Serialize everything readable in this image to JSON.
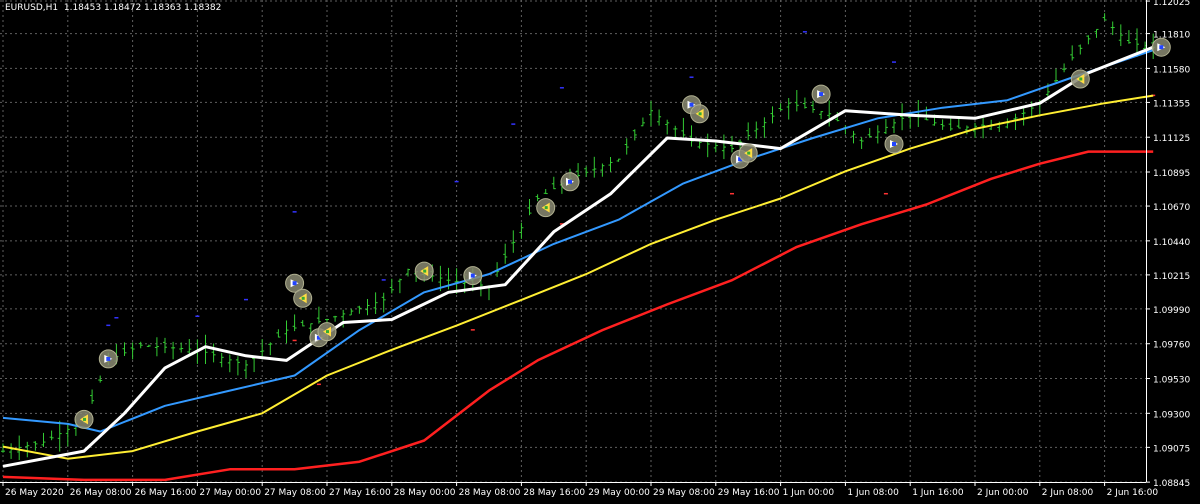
{
  "header": {
    "symbol_tf": "EURUSD,H1",
    "open": "1.18453",
    "high": "1.18472",
    "low": "1.18363",
    "close": "1.18382"
  },
  "colors": {
    "background": "#000000",
    "grid": "#606060",
    "candle": "#33cc33",
    "ma_fast": "#ffffff",
    "ma_mid": "#3399ff",
    "ma_slow": "#ffee33",
    "ma_slowest": "#ff2020",
    "axis_text": "#ffffff",
    "dots_up": "#3333ff",
    "dots_down": "#ff3333"
  },
  "chart_data": {
    "type": "line",
    "symbol": "EURUSD",
    "timeframe": "H1",
    "ylim": [
      1.08846,
      1.12032
    ],
    "y_ticks": [
      "1.12025",
      "1.11810",
      "1.11580",
      "1.11355",
      "1.11125",
      "1.10895",
      "1.10670",
      "1.10440",
      "1.10215",
      "1.09990",
      "1.09760",
      "1.09530",
      "1.09300",
      "1.09075",
      "1.08845"
    ],
    "y_tick_values": [
      1.12025,
      1.1181,
      1.1158,
      1.11355,
      1.11125,
      1.10895,
      1.1067,
      1.1044,
      1.10215,
      1.0999,
      1.0976,
      1.0953,
      1.093,
      1.09075,
      1.08845
    ],
    "x_ticks": [
      "26 May 2020",
      "26 May 08:00",
      "26 May 16:00",
      "27 May 00:00",
      "27 May 08:00",
      "27 May 16:00",
      "28 May 00:00",
      "28 May 08:00",
      "28 May 16:00",
      "29 May 00:00",
      "29 May 08:00",
      "29 May 16:00",
      "1 Jun 00:00",
      "1 Jun 08:00",
      "1 Jun 16:00",
      "2 Jun 00:00",
      "2 Jun 08:00",
      "2 Jun 16:00"
    ],
    "x_tick_index": [
      0,
      8,
      16,
      24,
      32,
      40,
      48,
      56,
      64,
      72,
      80,
      88,
      96,
      104,
      112,
      120,
      128,
      136
    ],
    "bar_count": 143,
    "price_anchors": [
      [
        0,
        1.0905
      ],
      [
        5,
        1.0911
      ],
      [
        10,
        1.0925
      ],
      [
        13,
        1.0965
      ],
      [
        17,
        1.0975
      ],
      [
        24,
        1.0972
      ],
      [
        30,
        1.0962
      ],
      [
        35,
        1.0985
      ],
      [
        40,
        1.0992
      ],
      [
        47,
        1.1005
      ],
      [
        50,
        1.1025
      ],
      [
        55,
        1.1018
      ],
      [
        60,
        1.1014
      ],
      [
        66,
        1.1072
      ],
      [
        70,
        1.1085
      ],
      [
        76,
        1.1098
      ],
      [
        80,
        1.113
      ],
      [
        85,
        1.111
      ],
      [
        90,
        1.1105
      ],
      [
        97,
        1.1135
      ],
      [
        102,
        1.1128
      ],
      [
        106,
        1.111
      ],
      [
        112,
        1.1128
      ],
      [
        117,
        1.1118
      ],
      [
        124,
        1.1122
      ],
      [
        128,
        1.1135
      ],
      [
        132,
        1.1165
      ],
      [
        136,
        1.119
      ],
      [
        139,
        1.1175
      ],
      [
        142,
        1.1172
      ]
    ],
    "series": [
      {
        "key": "ma_fast",
        "values": [
          [
            0,
            1.0895
          ],
          [
            10,
            1.0905
          ],
          [
            15,
            1.093
          ],
          [
            20,
            1.096
          ],
          [
            25,
            1.0974
          ],
          [
            30,
            1.0968
          ],
          [
            35,
            1.0965
          ],
          [
            42,
            1.099
          ],
          [
            48,
            1.0992
          ],
          [
            55,
            1.101
          ],
          [
            62,
            1.1015
          ],
          [
            68,
            1.105
          ],
          [
            75,
            1.1075
          ],
          [
            82,
            1.1112
          ],
          [
            88,
            1.111
          ],
          [
            96,
            1.1105
          ],
          [
            104,
            1.113
          ],
          [
            112,
            1.1127
          ],
          [
            120,
            1.1125
          ],
          [
            128,
            1.1135
          ],
          [
            134,
            1.1155
          ],
          [
            142,
            1.1172
          ]
        ]
      },
      {
        "key": "ma_mid",
        "values": [
          [
            0,
            1.0927
          ],
          [
            8,
            1.0923
          ],
          [
            12,
            1.0918
          ],
          [
            20,
            1.0935
          ],
          [
            28,
            1.0945
          ],
          [
            36,
            1.0955
          ],
          [
            44,
            1.0985
          ],
          [
            52,
            1.101
          ],
          [
            60,
            1.1022
          ],
          [
            68,
            1.1042
          ],
          [
            76,
            1.1058
          ],
          [
            84,
            1.1082
          ],
          [
            92,
            1.1098
          ],
          [
            100,
            1.1112
          ],
          [
            108,
            1.1125
          ],
          [
            116,
            1.1132
          ],
          [
            124,
            1.1137
          ],
          [
            132,
            1.1152
          ],
          [
            142,
            1.117
          ]
        ]
      },
      {
        "key": "ma_slow",
        "values": [
          [
            0,
            1.0908
          ],
          [
            8,
            1.09
          ],
          [
            16,
            1.0905
          ],
          [
            24,
            1.0918
          ],
          [
            32,
            1.093
          ],
          [
            40,
            1.0955
          ],
          [
            48,
            1.0972
          ],
          [
            56,
            1.0988
          ],
          [
            64,
            1.1005
          ],
          [
            72,
            1.1022
          ],
          [
            80,
            1.1042
          ],
          [
            88,
            1.1058
          ],
          [
            96,
            1.1072
          ],
          [
            104,
            1.109
          ],
          [
            112,
            1.1105
          ],
          [
            120,
            1.1118
          ],
          [
            128,
            1.1127
          ],
          [
            136,
            1.1135
          ],
          [
            142,
            1.114
          ]
        ]
      },
      {
        "key": "ma_slowest",
        "values": [
          [
            0,
            1.0888
          ],
          [
            10,
            1.0886
          ],
          [
            20,
            1.0886
          ],
          [
            28,
            1.0893
          ],
          [
            36,
            1.0893
          ],
          [
            44,
            1.0898
          ],
          [
            52,
            1.0912
          ],
          [
            60,
            1.0945
          ],
          [
            66,
            1.0965
          ],
          [
            74,
            1.0985
          ],
          [
            82,
            1.1002
          ],
          [
            90,
            1.1018
          ],
          [
            98,
            1.104
          ],
          [
            106,
            1.1055
          ],
          [
            114,
            1.1068
          ],
          [
            122,
            1.1085
          ],
          [
            128,
            1.1095
          ],
          [
            134,
            1.1103
          ],
          [
            142,
            1.1103
          ]
        ]
      }
    ],
    "markers": [
      {
        "i": 10,
        "p": 1.0926,
        "kind": "sell"
      },
      {
        "i": 13,
        "p": 1.0966,
        "kind": "buy"
      },
      {
        "i": 36,
        "p": 1.1016,
        "kind": "buy"
      },
      {
        "i": 37,
        "p": 1.1006,
        "kind": "sell"
      },
      {
        "i": 39,
        "p": 1.098,
        "kind": "buy"
      },
      {
        "i": 40,
        "p": 1.0984,
        "kind": "sell"
      },
      {
        "i": 52,
        "p": 1.1024,
        "kind": "sell"
      },
      {
        "i": 58,
        "p": 1.1021,
        "kind": "buy"
      },
      {
        "i": 67,
        "p": 1.1066,
        "kind": "sell"
      },
      {
        "i": 70,
        "p": 1.1083,
        "kind": "buy"
      },
      {
        "i": 85,
        "p": 1.1134,
        "kind": "buy"
      },
      {
        "i": 86,
        "p": 1.1128,
        "kind": "sell"
      },
      {
        "i": 91,
        "p": 1.1098,
        "kind": "buy"
      },
      {
        "i": 92,
        "p": 1.1102,
        "kind": "sell"
      },
      {
        "i": 101,
        "p": 1.1141,
        "kind": "buy"
      },
      {
        "i": 110,
        "p": 1.1108,
        "kind": "buy"
      },
      {
        "i": 133,
        "p": 1.1151,
        "kind": "sell"
      },
      {
        "i": 143,
        "p": 1.1172,
        "kind": "buy"
      }
    ],
    "dots": [
      [
        13,
        1.0988,
        "up"
      ],
      [
        14,
        1.0993,
        "up"
      ],
      [
        24,
        1.0994,
        "up"
      ],
      [
        30,
        1.1005,
        "up"
      ],
      [
        36,
        1.1063,
        "up"
      ],
      [
        47,
        1.1018,
        "up"
      ],
      [
        56,
        1.1083,
        "up"
      ],
      [
        63,
        1.1121,
        "up"
      ],
      [
        69,
        1.1145,
        "up"
      ],
      [
        85,
        1.1152,
        "up"
      ],
      [
        99,
        1.1182,
        "up"
      ],
      [
        110,
        1.1162,
        "up"
      ],
      [
        6,
        1.0901,
        "down"
      ],
      [
        36,
        1.0978,
        "down"
      ],
      [
        39,
        1.0949,
        "down"
      ],
      [
        58,
        1.0985,
        "down"
      ],
      [
        69,
        1.1055,
        "down"
      ],
      [
        90,
        1.1075,
        "down"
      ],
      [
        109,
        1.1075,
        "down"
      ],
      [
        142,
        1.114,
        "down"
      ]
    ]
  }
}
